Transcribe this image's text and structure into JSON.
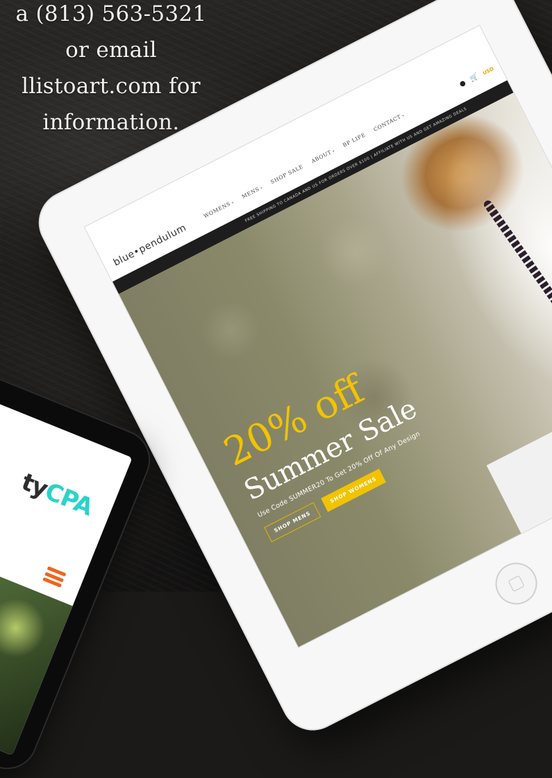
{
  "contact": {
    "line1": "a (813) 563-5321",
    "line2": "or email",
    "line3": "llistoart.com for",
    "line4": "information."
  },
  "site": {
    "logo": "blue•pendulum",
    "nav": [
      "WOMENS",
      "MENS",
      "SHOP SALE",
      "ABOUT",
      "BP LIFE",
      "CONTACT"
    ],
    "currency": "USD",
    "announcement": "FREE SHIPPING TO CANADA AND US FOR ORDERS OVER $100 | AFFILIATE WITH US AND GET AMAZING DEALS",
    "hero": {
      "headline_pct": "20% off",
      "headline_sale": "Summer Sale",
      "promo": "Use Code SUMMER20 To Get 20% Off Of Any Design",
      "btn_mens": "SHOP MENS",
      "btn_womens": "SHOP WOMENS"
    }
  },
  "phone": {
    "logo_dark": "ty",
    "logo_accent": "CPA"
  },
  "icons": {
    "account": "user-icon",
    "cart": "cart-icon",
    "menu": "hamburger-menu-icon",
    "home": "home-button-icon"
  },
  "colors": {
    "accent_yellow": "#f2c300",
    "phone_teal": "#2ad3c9",
    "menu_orange": "#f0641e",
    "announce_bar": "#1d1d1d"
  }
}
